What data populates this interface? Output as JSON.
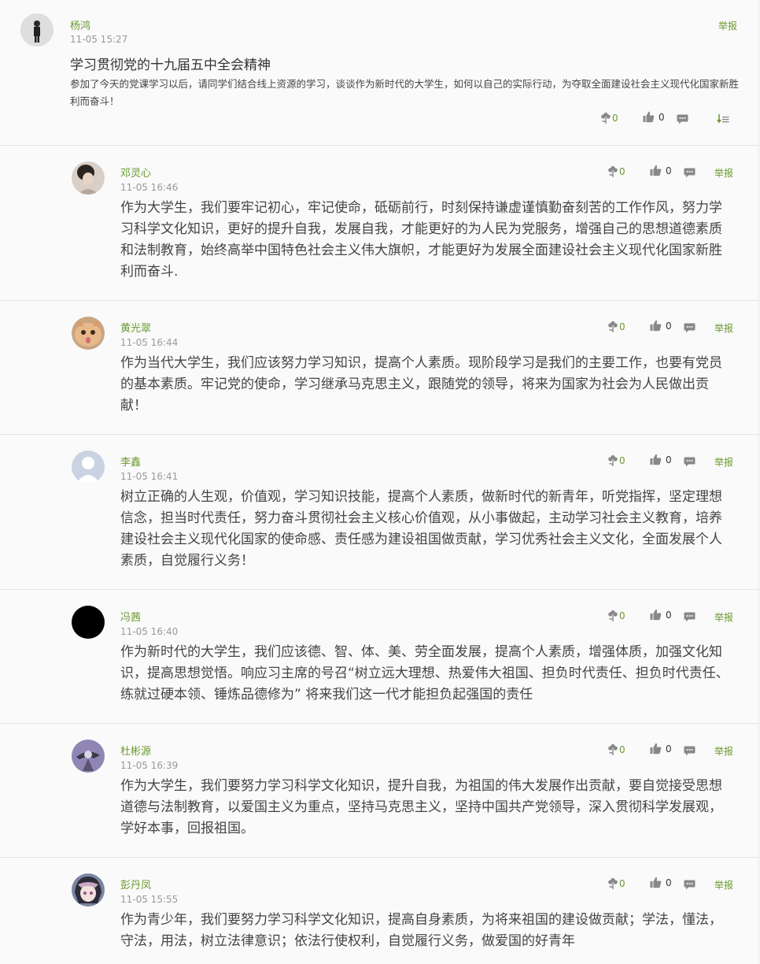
{
  "post": {
    "author": "杨鸿",
    "time": "11-05 15:27",
    "title": "学习贯彻党的十九届五中全会精神",
    "body": "参加了今天的党课学习以后，请同学们结合线上资源的学习，谈谈作为新时代的大学生，如何以自己的实际行动，为夺取全面建设社会主义现代化国家新胜利而奋斗！",
    "report_label": "举报",
    "flower_count": "0",
    "like_count": "0"
  },
  "replies": [
    {
      "author": "邓灵心",
      "time": "11-05 16:46",
      "content": "作为大学生，我们要牢记初心，牢记使命，砥砺前行，时刻保持谦虚谨慎勤奋刻苦的工作作风，努力学习科学文化知识，更好的提升自我，发展自我，才能更好的为人民为党服务，增强自己的思想道德素质和法制教育，始终高举中国特色社会主义伟大旗帜，才能更好为发展全面建设社会主义现代化国家新胜利而奋斗.",
      "flower_count": "0",
      "like_count": "0",
      "report_label": "举报"
    },
    {
      "author": "黄光翠",
      "time": "11-05 16:44",
      "content": "作为当代大学生，我们应该努力学习知识，提高个人素质。现阶段学习是我们的主要工作，也要有党员的基本素质。牢记党的使命，学习继承马克思主义，跟随党的领导，将来为国家为社会为人民做出贡献！",
      "flower_count": "0",
      "like_count": "0",
      "report_label": "举报"
    },
    {
      "author": "李鑫",
      "time": "11-05 16:41",
      "content": "树立正确的人生观，价值观，学习知识技能，提高个人素质，做新时代的新青年，听党指挥，坚定理想信念，担当时代责任，努力奋斗贯彻社会主义核心价值观，从小事做起，主动学习社会主义教育，培养建设社会主义现代化国家的使命感、责任感为建设祖国做贡献，学习优秀社会主义文化，全面发展个人素质，自觉履行义务！",
      "flower_count": "0",
      "like_count": "0",
      "report_label": "举报"
    },
    {
      "author": "冯茜",
      "time": "11-05 16:40",
      "content": "作为新时代的大学生，我们应该德、智、体、美、劳全面发展，提高个人素质，增强体质，加强文化知识，提高思想觉悟。响应习主席的号召“树立远大理想、热爱伟大祖国、担负时代责任、担负时代责任、练就过硬本领、锤炼品德修为” 将来我们这一代才能担负起强国的责任",
      "flower_count": "0",
      "like_count": "0",
      "report_label": "举报"
    },
    {
      "author": "杜彬源",
      "time": "11-05 16:39",
      "content": "作为大学生，我们要努力学习科学文化知识，提升自我，为祖国的伟大发展作出贡献，要自觉接受思想道德与法制教育，以爱国主义为重点，坚持马克思主义，坚持中国共产党领导，深入贯彻科学发展观，学好本事，回报祖国。",
      "flower_count": "0",
      "like_count": "0",
      "report_label": "举报"
    },
    {
      "author": "彭丹凤",
      "time": "11-05 15:55",
      "content": "作为青少年，我们要努力学习科学文化知识，提高自身素质，为将来祖国的建设做贡献；学法，懂法，守法，用法，树立法律意识；依法行使权利，自觉履行义务，做爱国的好青年",
      "flower_count": "0",
      "like_count": "0",
      "report_label": "举报"
    }
  ]
}
